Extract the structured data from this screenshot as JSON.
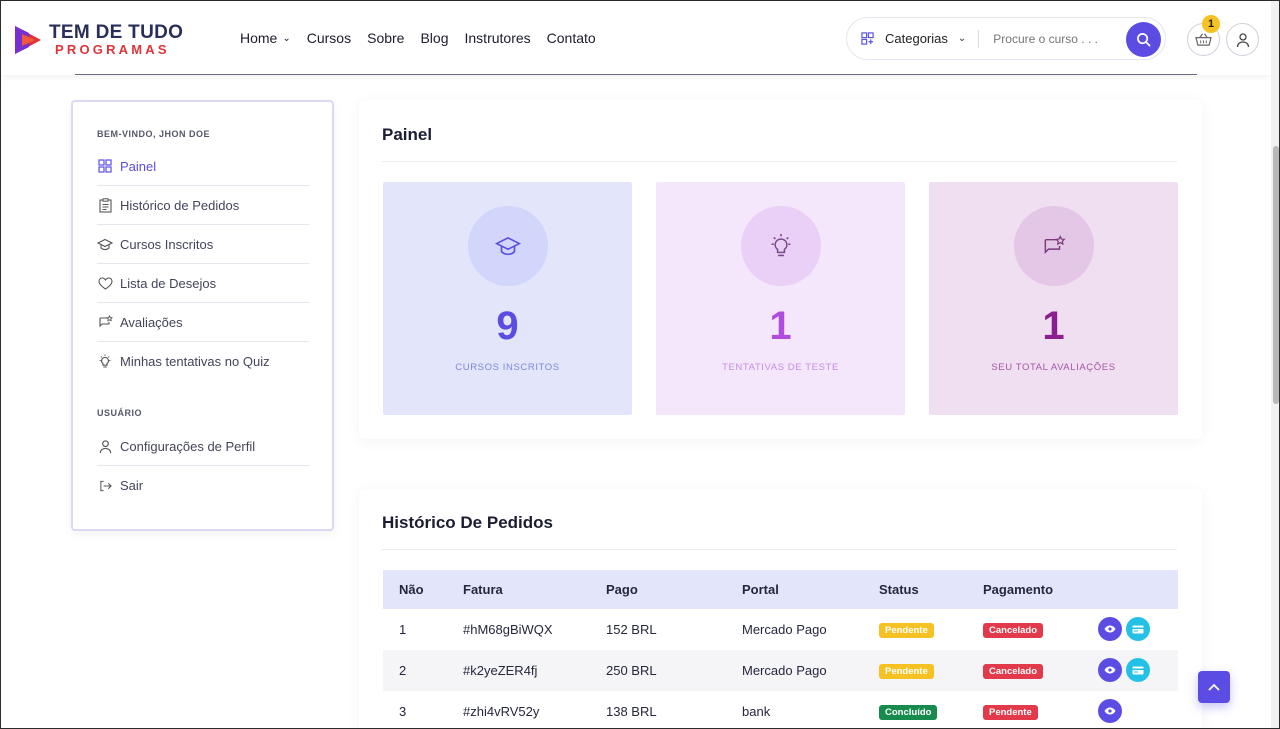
{
  "header": {
    "logo_top": "TEM DE TUDO",
    "logo_bottom": "PROGRAMAS",
    "nav": [
      {
        "label": "Home",
        "has_dropdown": true
      },
      {
        "label": "Cursos"
      },
      {
        "label": "Sobre"
      },
      {
        "label": "Blog"
      },
      {
        "label": "Instrutores"
      },
      {
        "label": "Contato"
      }
    ],
    "categories_label": "Categorias",
    "search_placeholder": "Procure o curso . . .",
    "cart_count": "1"
  },
  "sidebar": {
    "welcome": "BEM-VINDO, JHON DOE",
    "items": [
      {
        "label": "Painel",
        "icon": "grid-icon",
        "active": true
      },
      {
        "label": "Histórico de Pedidos",
        "icon": "clipboard-icon"
      },
      {
        "label": "Cursos Inscritos",
        "icon": "graduation-cap-icon"
      },
      {
        "label": "Lista de Desejos",
        "icon": "heart-icon"
      },
      {
        "label": "Avaliações",
        "icon": "review-icon"
      },
      {
        "label": "Minhas tentativas no Quiz",
        "icon": "bulb-icon"
      }
    ],
    "user_heading": "USUÁRIO",
    "user_items": [
      {
        "label": "Configurações de Perfil",
        "icon": "user-icon"
      },
      {
        "label": "Sair",
        "icon": "logout-icon"
      }
    ]
  },
  "dashboard": {
    "title": "Painel",
    "stats": [
      {
        "value": "9",
        "label": "CURSOS INSCRITOS",
        "icon": "graduation-cap-icon",
        "bg": "#e3e6fb",
        "circle": "#d1d6fa",
        "color": "#5b4de4",
        "label_color": "#7f86d8"
      },
      {
        "value": "1",
        "label": "TENTATIVAS DE TESTE",
        "icon": "bulb-icon",
        "bg": "#f4e6fb",
        "circle": "#ead0f6",
        "color": "#b04de0",
        "label_color": "#c58ede"
      },
      {
        "value": "1",
        "label": "SEU TOTAL AVALIAÇÕES",
        "icon": "review-icon",
        "bg": "#efdff0",
        "circle": "#e4c6e6",
        "color": "#8b1f8f",
        "label_color": "#a656a8"
      }
    ]
  },
  "orders": {
    "title": "Histórico De Pedidos",
    "columns": [
      "Não",
      "Fatura",
      "Pago",
      "Portal",
      "Status",
      "Pagamento"
    ],
    "rows": [
      {
        "no": "1",
        "invoice": "#hM68gBiWQX",
        "paid": "152 BRL",
        "portal": "Mercado Pago",
        "status": "Pendente",
        "payment": "Cancelado",
        "show_pay": true
      },
      {
        "no": "2",
        "invoice": "#k2yeZER4fj",
        "paid": "250 BRL",
        "portal": "Mercado Pago",
        "status": "Pendente",
        "payment": "Cancelado",
        "show_pay": true
      },
      {
        "no": "3",
        "invoice": "#zhi4vRV52y",
        "paid": "138 BRL",
        "portal": "bank",
        "status": "Concluído",
        "payment": "Pendente",
        "show_pay": false
      }
    ]
  },
  "colors": {
    "accent": "#5b4de4",
    "pending": "#f6c223",
    "cancel": "#e23a4a",
    "done": "#178a4d",
    "pay": "#23c1e6"
  }
}
